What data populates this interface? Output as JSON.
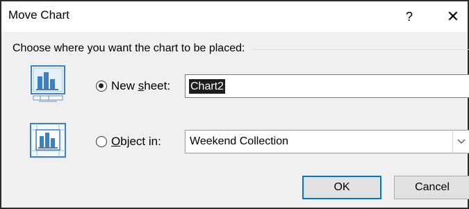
{
  "window": {
    "title": "Move Chart",
    "help_label": "?",
    "close_label": "✕"
  },
  "prompt": "Choose where you want the chart to be placed:",
  "options": {
    "new_sheet": {
      "label_before": "New ",
      "label_access_key": "s",
      "label_after": "heet:",
      "selected": true,
      "value": "Chart2"
    },
    "object_in": {
      "label_access_key": "O",
      "label_after": "bject in:",
      "selected": false,
      "value": "Weekend Collection"
    }
  },
  "buttons": {
    "ok": "OK",
    "cancel": "Cancel"
  },
  "icons": {
    "new_sheet": "chart-sheet-icon",
    "object_in": "embedded-chart-icon",
    "dropdown": "chevron-down-icon"
  },
  "colors": {
    "accent": "#0078d7",
    "icon_blue": "#3b7fc4",
    "selection_bg": "#1e1e1e"
  }
}
